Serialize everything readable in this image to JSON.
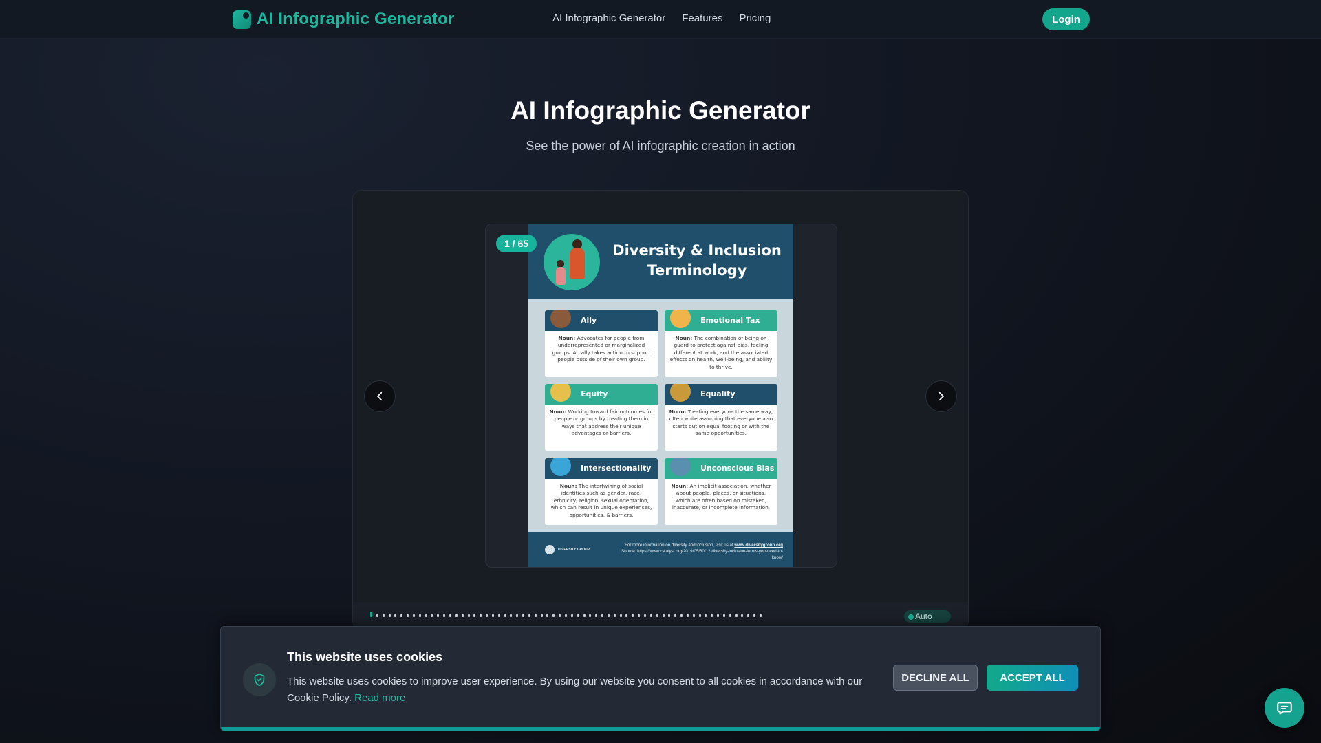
{
  "header": {
    "brand": "AI Infographic Generator",
    "nav": [
      "AI Infographic Generator",
      "Features",
      "Pricing"
    ],
    "login_label": "Login"
  },
  "hero": {
    "title": "AI Infographic Generator",
    "subtitle": "See the power of AI infographic creation in action"
  },
  "carousel": {
    "counter": "1 / 65",
    "total_slides": 65,
    "current_slide": 1,
    "auto_label": "Auto",
    "slide": {
      "title": "Diversity & Inclusion Terminology",
      "cards": [
        {
          "label": "Ally",
          "style": "navy",
          "icon": "fist-icon",
          "noun": "Noun:",
          "text": "Advocates for people from underrepresented or marginalized groups. An ally takes action to support people outside of their own group."
        },
        {
          "label": "Emotional Tax",
          "style": "teal",
          "icon": "hand-icon",
          "noun": "Noun:",
          "text": "The combination of being on guard to protect against bias, feeling different at work, and the associated effects on health, well-being, and ability to thrive."
        },
        {
          "label": "Equity",
          "style": "teal",
          "icon": "coins-icon",
          "noun": "Noun:",
          "text": "Working toward fair outcomes for people or groups by treating them in ways that address their unique advantages or barriers."
        },
        {
          "label": "Equality",
          "style": "navy",
          "icon": "scales-icon",
          "noun": "Noun:",
          "text": "Treating everyone the same way, often while assuming that everyone also starts out on equal footing or with the same opportunities."
        },
        {
          "label": "Intersectionality",
          "style": "navy",
          "icon": "network-icon",
          "noun": "Noun:",
          "text": "The intertwining of social identities such as gender, race, ethnicity, religion, sexual orientation, which can result in unique experiences, opportunities, & barriers."
        },
        {
          "label": "Unconscious Bias",
          "style": "teal",
          "icon": "magnifier-icon",
          "noun": "Noun:",
          "text": "An implicit association, whether about people, places, or situations, which are often based on mistaken, inaccurate, or incomplete information."
        }
      ],
      "footer_logo": "DIVERSITY GROUP",
      "footer_text": "For more information on diversity and inclusion, visit us at",
      "footer_link": "www.diversitygroup.org",
      "footer_source": "Source: https://www.catalyst.org/2019/05/30/12-diversity-inclusion-terms-you-need-to-know/"
    }
  },
  "cookie": {
    "title": "This website uses cookies",
    "text": "This website uses cookies to improve user experience. By using our website you consent to all cookies in accordance with our Cookie Policy.",
    "read_more": "Read more",
    "decline_label": "DECLINE ALL",
    "accept_label": "ACCEPT ALL"
  },
  "colors": {
    "accent": "#17b39a",
    "infographic_navy": "#1f4f6b",
    "infographic_teal": "#2fae94"
  }
}
